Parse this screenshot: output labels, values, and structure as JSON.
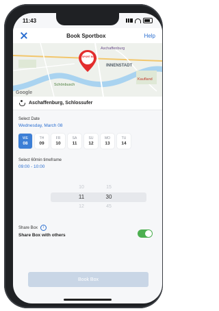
{
  "status": {
    "time": "11:43"
  },
  "header": {
    "title": "Book Sportbox",
    "help": "Help"
  },
  "map": {
    "pin_text": "SPORT BOX",
    "labels": [
      "Aschaffenburg",
      "INNENSTADT",
      "Kaufland",
      "Schönbusch"
    ],
    "attribution": "Google"
  },
  "location": {
    "name": "Aschaffenburg, Schlossufer"
  },
  "date": {
    "label": "Select Date",
    "value": "Wednesday, March 08",
    "days": [
      {
        "name": "WE",
        "num": "08",
        "selected": true
      },
      {
        "name": "TH",
        "num": "09",
        "selected": false
      },
      {
        "name": "FR",
        "num": "10",
        "selected": false
      },
      {
        "name": "SA",
        "num": "11",
        "selected": false
      },
      {
        "name": "SU",
        "num": "12",
        "selected": false
      },
      {
        "name": "MO",
        "num": "13",
        "selected": false
      },
      {
        "name": "TU",
        "num": "14",
        "selected": false
      }
    ]
  },
  "timeframe": {
    "label": "Select 60min timeframe",
    "value": "09:00 - 10:00",
    "hours": [
      "10",
      "11",
      "12"
    ],
    "minutes": [
      "15",
      "30",
      "45"
    ]
  },
  "share": {
    "label": "Share Box",
    "toggle_label": "Share Box with others",
    "enabled": true
  },
  "book_button": "Book Box",
  "colors": {
    "accent": "#2a6ed0",
    "selected_day": "#3d7fd6",
    "toggle_on": "#4caf50",
    "disabled_button": "#c9d6e6"
  }
}
